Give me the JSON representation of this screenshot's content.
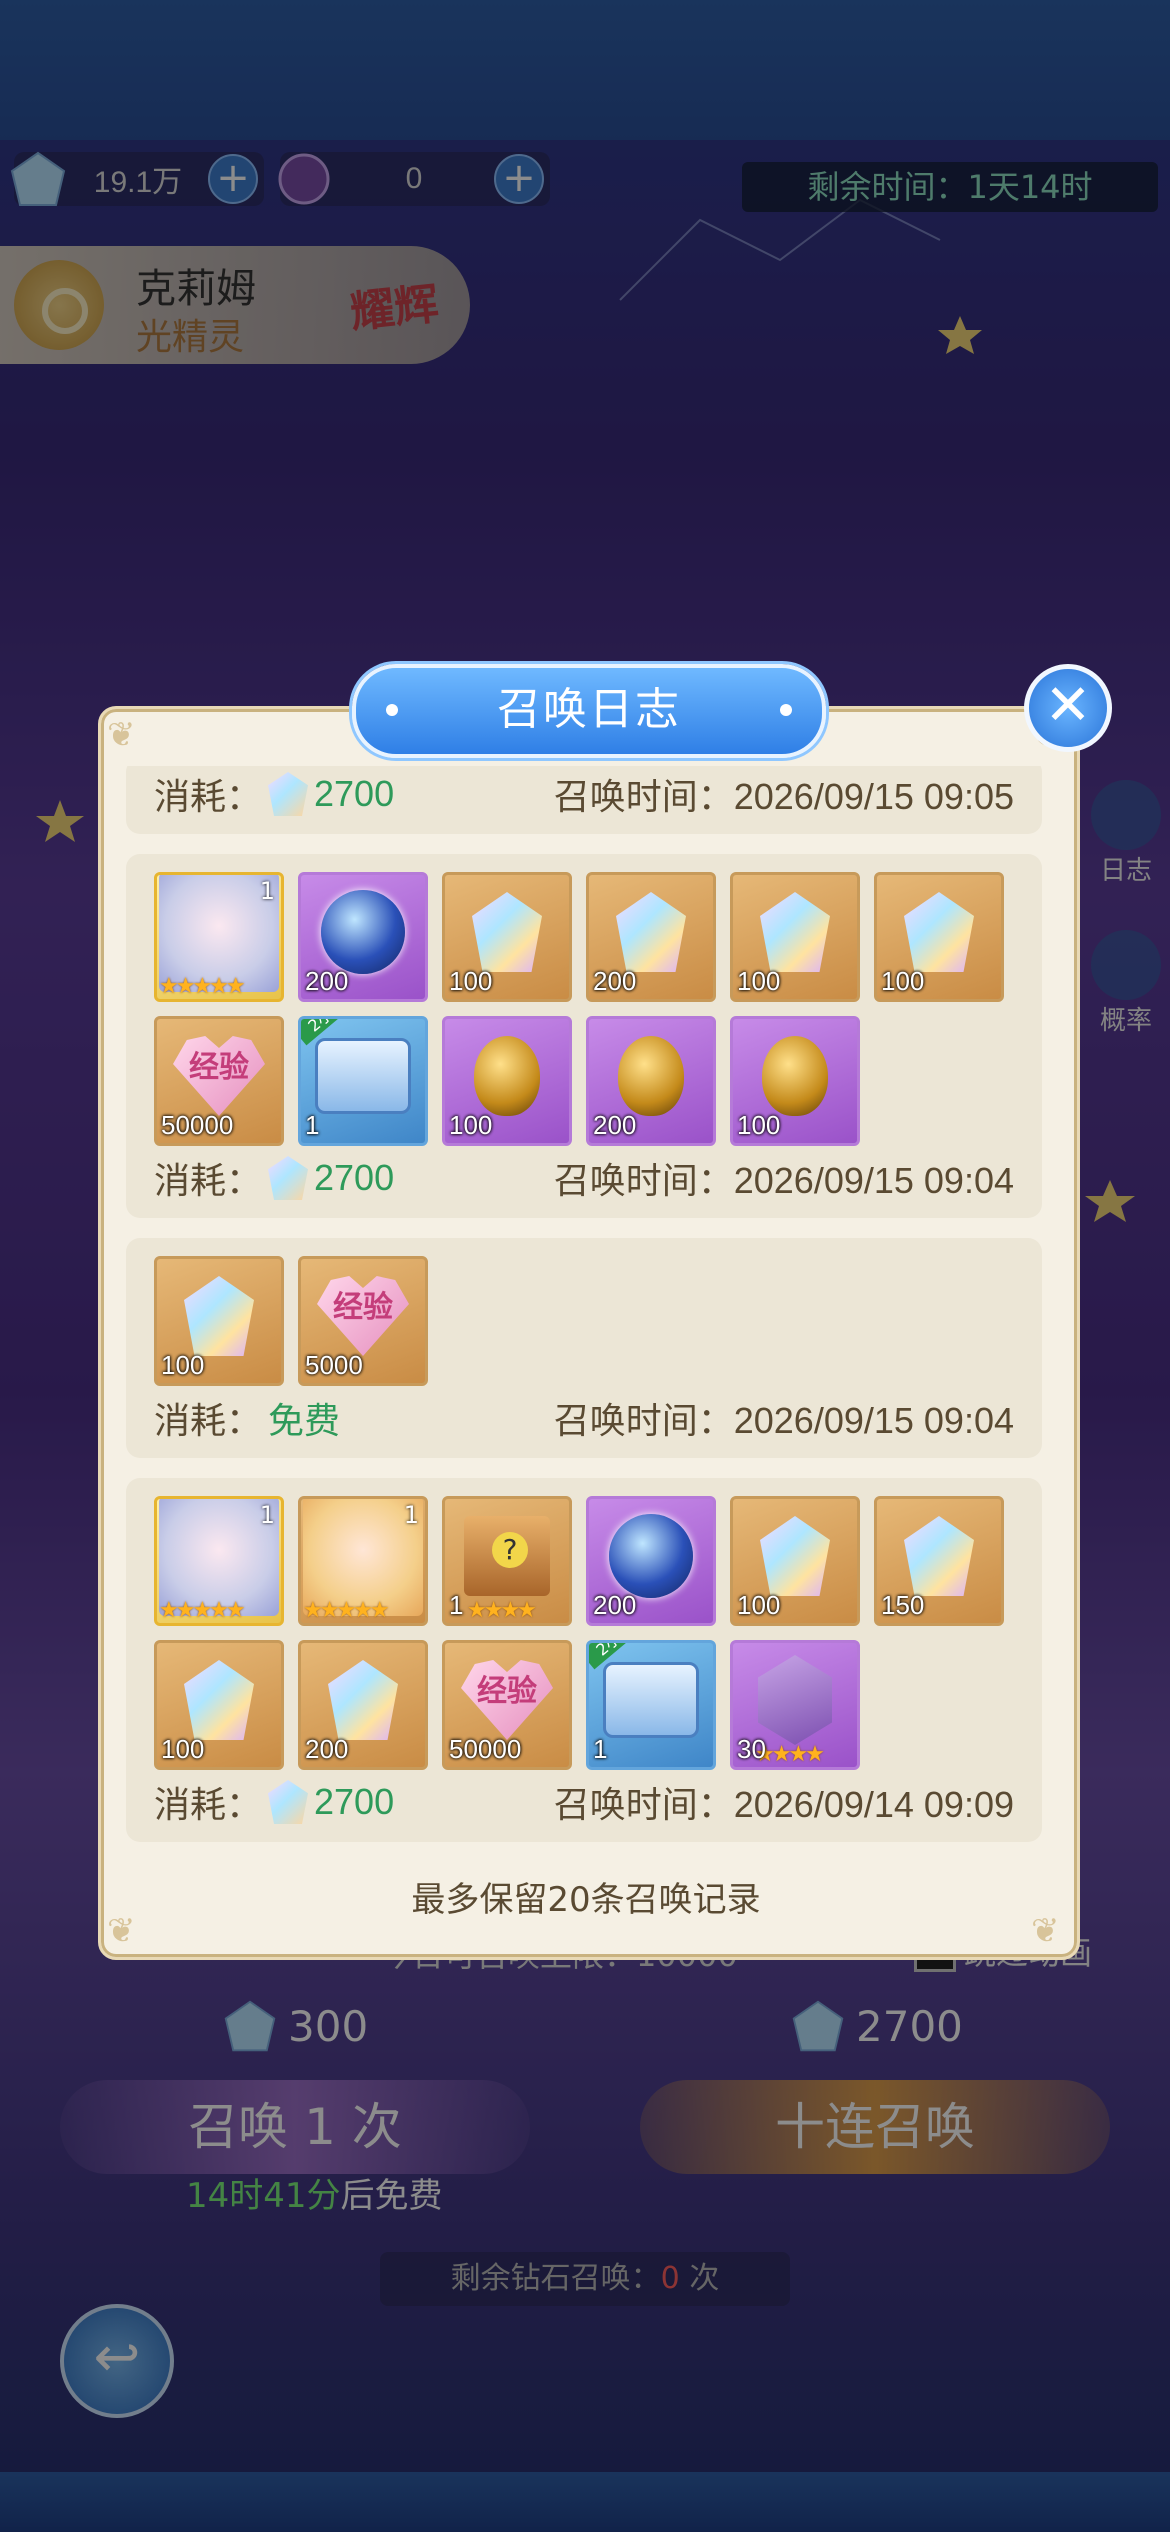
{
  "header": {
    "diamonds": "19.1万",
    "tickets": "0",
    "timer_label": "剩余时间：1天14时"
  },
  "hero": {
    "name": "克莉姆",
    "type": "光精灵",
    "badge": "耀辉"
  },
  "side": {
    "log_label": "日志",
    "rate_label": "概率"
  },
  "bottom": {
    "single_cost": "300",
    "ten_cost": "2700",
    "single_button": "召唤 1 次",
    "ten_button": "十连召唤",
    "free_time": "14时41分",
    "free_suffix": "后免费",
    "remaining_label": "剩余钻石召唤：",
    "remaining_count": "0",
    "remaining_unit": "次",
    "skip_label": "跳过动画",
    "behind_text": "今日可召唤上限：10000"
  },
  "modal": {
    "title": "召唤日志",
    "footnote": "最多保留20条召唤记录",
    "cost_label": "消耗：",
    "time_label": "召唤时间：",
    "entries": [
      {
        "items": [],
        "cost": "2700",
        "time": "2026/09/15 09:05"
      },
      {
        "items": [
          {
            "kind": "face",
            "bg": "yellow",
            "qty": "",
            "level": "1",
            "stars": "★★★★★"
          },
          {
            "kind": "orb",
            "bg": "purple",
            "qty": "200"
          },
          {
            "kind": "crystal",
            "bg": "gold",
            "qty": "100"
          },
          {
            "kind": "crystal",
            "bg": "gold",
            "qty": "200"
          },
          {
            "kind": "crystal",
            "bg": "gold",
            "qty": "100"
          },
          {
            "kind": "crystal",
            "bg": "gold",
            "qty": "100"
          },
          {
            "kind": "heart",
            "bg": "gold",
            "qty": "50000",
            "text": "经验"
          },
          {
            "kind": "chest",
            "bg": "blue",
            "qty": "1",
            "tag": "2小时"
          },
          {
            "kind": "egg",
            "bg": "purple",
            "qty": "100"
          },
          {
            "kind": "egg",
            "bg": "purple",
            "qty": "200"
          },
          {
            "kind": "egg",
            "bg": "purple",
            "qty": "100"
          }
        ],
        "cost": "2700",
        "time": "2026/09/15 09:04"
      },
      {
        "items": [
          {
            "kind": "crystal",
            "bg": "gold",
            "qty": "100"
          },
          {
            "kind": "heart",
            "bg": "gold",
            "qty": "5000",
            "text": "经验"
          }
        ],
        "cost_free": "免费",
        "time": "2026/09/15 09:04"
      },
      {
        "items": [
          {
            "kind": "face",
            "bg": "yellow",
            "qty": "",
            "level": "1",
            "stars": "★★★★★"
          },
          {
            "kind": "face2",
            "bg": "gold",
            "qty": "",
            "level": "1",
            "stars": "★★★★★"
          },
          {
            "kind": "mbox",
            "bg": "gold",
            "qty": "1",
            "stars": "★★★★"
          },
          {
            "kind": "orb",
            "bg": "purple",
            "qty": "200"
          },
          {
            "kind": "crystal",
            "bg": "gold",
            "qty": "100"
          },
          {
            "kind": "crystal",
            "bg": "gold",
            "qty": "150"
          },
          {
            "kind": "crystal",
            "bg": "gold",
            "qty": "100"
          },
          {
            "kind": "crystal",
            "bg": "gold",
            "qty": "200"
          },
          {
            "kind": "heart",
            "bg": "gold",
            "qty": "50000",
            "text": "经验"
          },
          {
            "kind": "chest",
            "bg": "blue",
            "qty": "1",
            "tag": "2小时"
          },
          {
            "kind": "shadowf",
            "bg": "purple",
            "qty": "30",
            "stars": "★★★★"
          }
        ],
        "cost": "2700",
        "time": "2026/09/14 09:09"
      }
    ]
  }
}
